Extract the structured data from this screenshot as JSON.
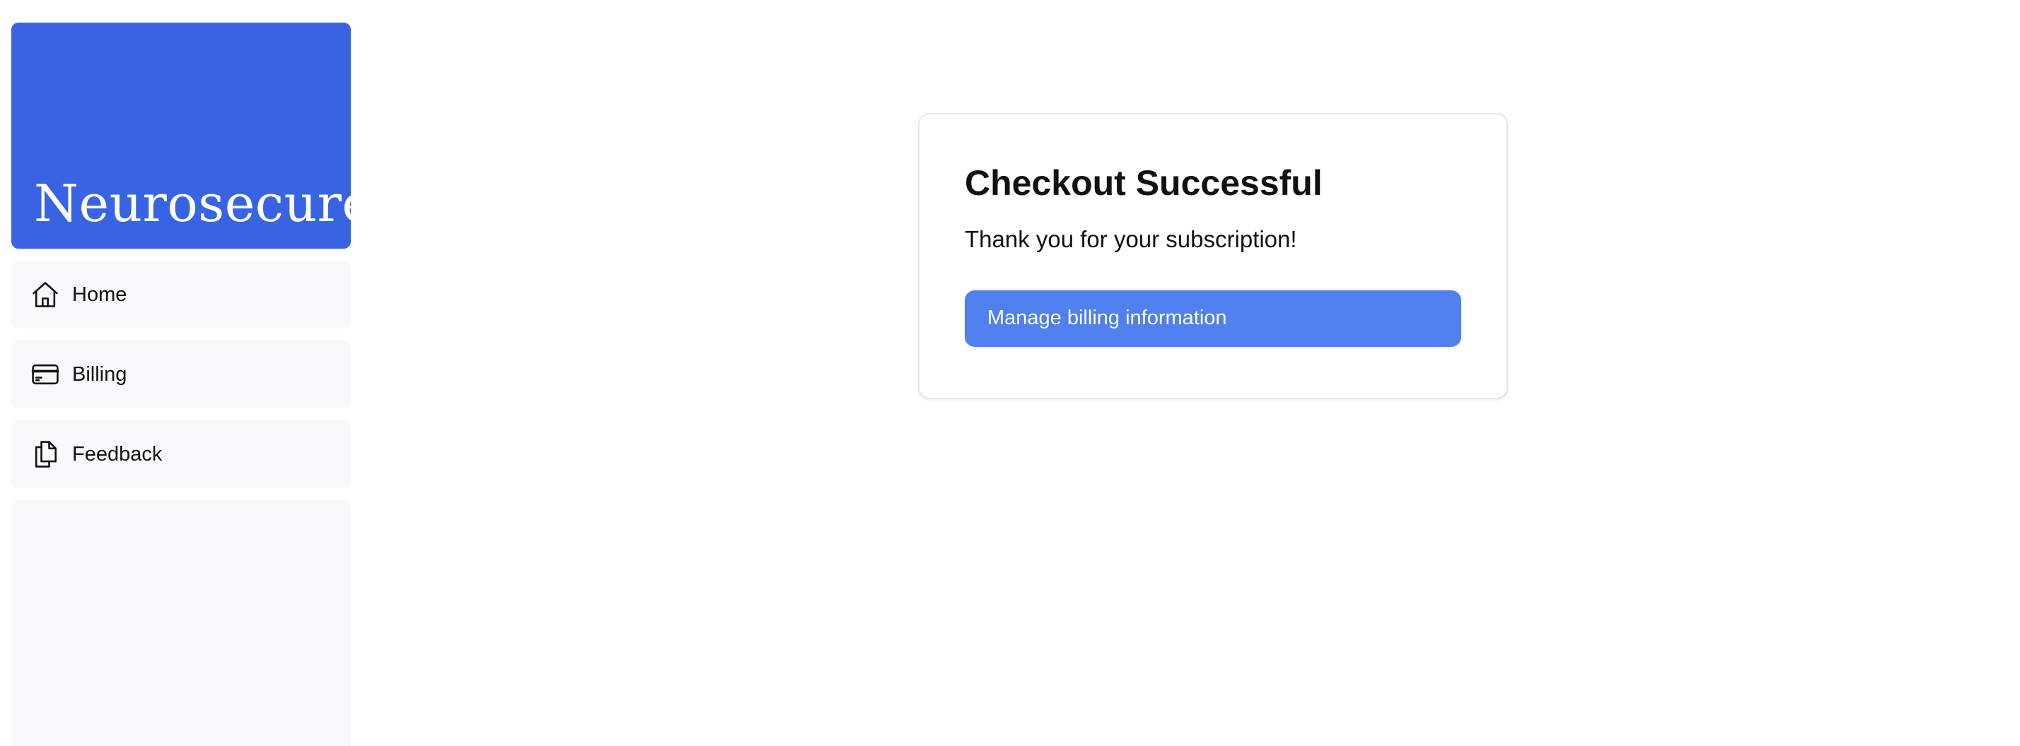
{
  "brand": {
    "name": "Neurosecure",
    "color": "#3863e3"
  },
  "sidebar": {
    "items": [
      {
        "label": "Home",
        "icon": "home-icon"
      },
      {
        "label": "Billing",
        "icon": "credit-card-icon"
      },
      {
        "label": "Feedback",
        "icon": "documents-icon"
      }
    ]
  },
  "card": {
    "title": "Checkout Successful",
    "message": "Thank you for your subscription!",
    "button_label": "Manage billing information",
    "button_color": "#4f80ed"
  }
}
